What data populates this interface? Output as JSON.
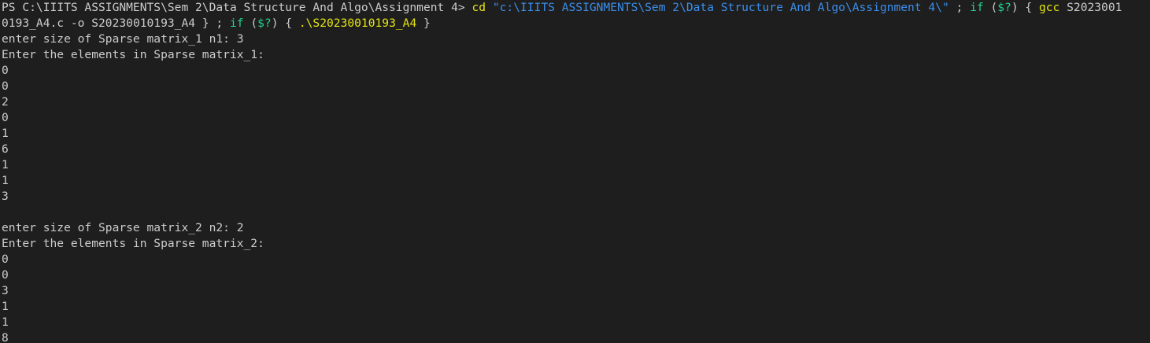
{
  "prompt_line": {
    "prompt": "PS C:\\IIITS ASSIGNMENTS\\Sem 2\\Data Structure And Algo\\Assignment 4> ",
    "cmd_cd": "cd",
    "path_string": "\"c:\\IIITS ASSIGNMENTS\\Sem 2\\Data Structure And Algo\\Assignment 4\\\"",
    "sep1": " ; ",
    "if1": "if",
    "cond1_open": " (",
    "cond1": "$?",
    "cond1_close": ") { ",
    "cmd_gcc": "gcc",
    "gcc_arg_part1": " S2023001"
  },
  "wrap_line": {
    "gcc_arg_part2": "0193_A4.c ",
    "flag_o": "-o",
    "out_name": " S20230010193_A4 } ; ",
    "if2": "if",
    "cond2_open": " (",
    "cond2": "$?",
    "cond2_close": ") { ",
    "run_cmd": ".\\S20230010193_A4",
    "close": " }"
  },
  "output_lines": [
    "enter size of Sparse matrix_1 n1: 3",
    "Enter the elements in Sparse matrix_1:",
    "0",
    "0",
    "2",
    "0",
    "1",
    "6",
    "1",
    "1",
    "3",
    "",
    "enter size of Sparse matrix_2 n2: 2",
    "Enter the elements in Sparse matrix_2:",
    "0",
    "0",
    "3",
    "1",
    "1",
    "8"
  ],
  "colors": {
    "background": "#1e1e1e",
    "foreground": "#cccccc",
    "command": "#e5e510",
    "string": "#3b8eea",
    "keyword": "#23d18b"
  }
}
